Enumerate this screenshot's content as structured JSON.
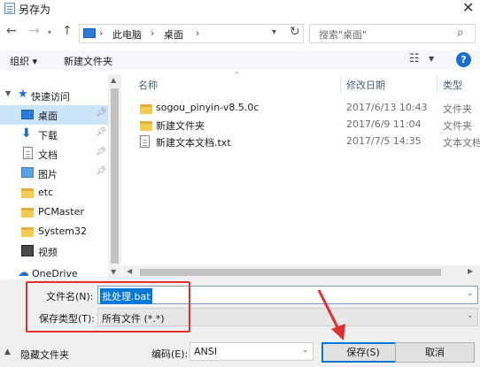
{
  "window": {
    "title": "另存为"
  },
  "navigation": {
    "back": "←",
    "forward": "→",
    "up": "↑",
    "breadcrumb": [
      "此电脑",
      "桌面"
    ],
    "search_placeholder": "搜索\"桌面\""
  },
  "toolbar": {
    "organize": "组织 ▾",
    "new_folder": "新建文件夹",
    "help": "?"
  },
  "sidebar": {
    "items": [
      {
        "label": "快速访问",
        "icon": "star-icon",
        "pinned": false
      },
      {
        "label": "桌面",
        "icon": "desktop-icon",
        "pinned": true,
        "selected": true
      },
      {
        "label": "下载",
        "icon": "download-icon",
        "pinned": true
      },
      {
        "label": "文档",
        "icon": "document-icon",
        "pinned": true
      },
      {
        "label": "图片",
        "icon": "picture-icon",
        "pinned": true
      },
      {
        "label": "etc",
        "icon": "folder-icon",
        "pinned": false
      },
      {
        "label": "PCMaster",
        "icon": "folder-icon",
        "pinned": false
      },
      {
        "label": "System32",
        "icon": "folder-icon",
        "pinned": false
      },
      {
        "label": "视频",
        "icon": "video-icon",
        "pinned": false
      },
      {
        "label": "OneDrive",
        "icon": "cloud-icon",
        "pinned": false
      }
    ]
  },
  "files": {
    "columns": [
      "名称",
      "修改日期",
      "类型"
    ],
    "rows": [
      {
        "name": "sogou_pinyin-v8.5.0c",
        "modified": "2017/6/13 10:43",
        "type": "文件夹",
        "icon": "folder-icon"
      },
      {
        "name": "新建文件夹",
        "modified": "2017/6/9 11:04",
        "type": "文件夹",
        "icon": "folder-icon"
      },
      {
        "name": "新建文本文档.txt",
        "modified": "2017/7/5 14:35",
        "type": "文本文档",
        "icon": "text-file-icon"
      }
    ]
  },
  "form": {
    "filename_label": "文件名(N):",
    "filename_value": "批处理.bat",
    "filetype_label": "保存类型(T):",
    "filetype_value": "所有文件  (*.*)",
    "encoding_label": "编码(E):",
    "encoding_value": "ANSI",
    "hide_folders": "隐藏文件夹",
    "save": "保存(S)",
    "cancel": "取消"
  },
  "colors": {
    "accent": "#0078d7",
    "annotation": "#e03030",
    "selection": "#cce4f7"
  }
}
